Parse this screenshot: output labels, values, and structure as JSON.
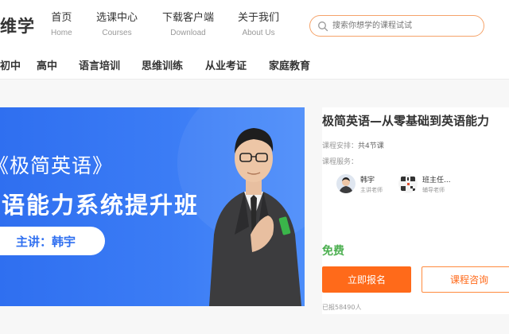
{
  "header": {
    "logo_text": "维学",
    "nav": [
      {
        "cn": "首页",
        "en": "Home"
      },
      {
        "cn": "选课中心",
        "en": "Courses"
      },
      {
        "cn": "下载客户端",
        "en": "Download"
      },
      {
        "cn": "关于我们",
        "en": "About Us"
      }
    ],
    "search_placeholder": "搜索你想学的课程试试",
    "accent_color": "#ff6a1a"
  },
  "categories": [
    "初中",
    "高中",
    "语言培训",
    "思维训练",
    "从业考证",
    "家庭教育"
  ],
  "banner": {
    "line1": "《极简英语》",
    "line2": "英语能力系统提升班",
    "pill_text": "主讲：韩宇",
    "bg_color": "#3070f0"
  },
  "course": {
    "title": "极简英语—从零基础到英语能力",
    "schedule_label": "课程安排：",
    "schedule_value": "共4节课",
    "service_label": "课程服务：",
    "teachers": [
      {
        "name": "韩宇",
        "role": "主讲老师"
      },
      {
        "name": "班主任...",
        "role": "辅导老师"
      }
    ],
    "price": "免费",
    "enroll_label": "立即报名",
    "consult_label": "课程咨询",
    "enrolled_count": "已报58490人"
  }
}
